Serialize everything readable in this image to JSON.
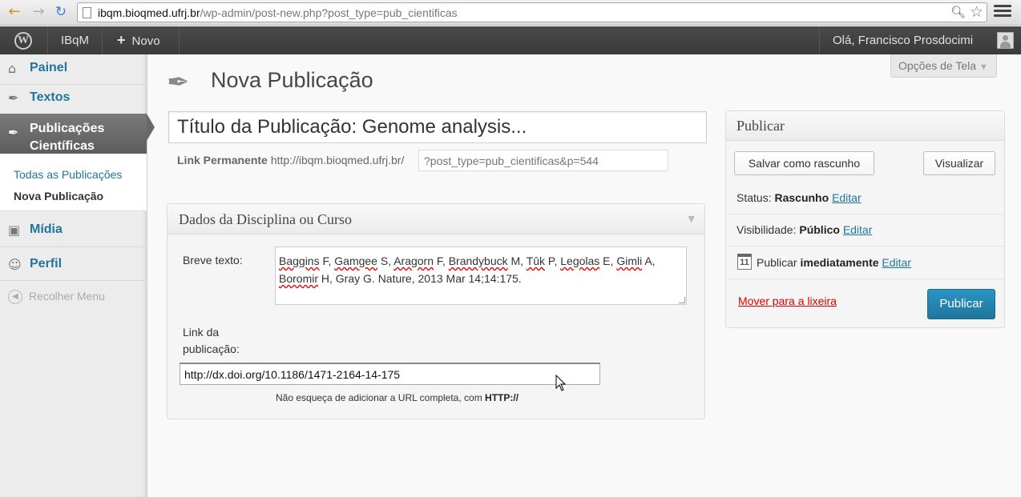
{
  "browser": {
    "url_host": "ibqm.bioqmed.ufrj.br",
    "url_path": "/wp-admin/post-new.php?post_type=pub_cientificas"
  },
  "adminbar": {
    "site_name": "IBqM",
    "new_label": "Novo",
    "greeting": "Olá, Francisco Prosdocimi"
  },
  "sidebar": {
    "items": [
      {
        "label": "Painel",
        "icon": "home-icon"
      },
      {
        "label": "Textos",
        "icon": "pushpin-icon"
      },
      {
        "label": "Publicações Científicas",
        "label_line1": "Publicações",
        "label_line2": "Científicas",
        "icon": "pushpin-icon"
      },
      {
        "label": "Mídia",
        "icon": "camera-icon"
      },
      {
        "label": "Perfil",
        "icon": "users-icon"
      }
    ],
    "submenu": [
      {
        "label": "Todas as Publicações"
      },
      {
        "label": "Nova Publicação"
      }
    ],
    "collapse_label": "Recolher Menu"
  },
  "header": {
    "screen_options": "Opções de Tela",
    "page_title": "Nova Publicação"
  },
  "editor": {
    "title_value": "Título da Publicação: Genome analysis...",
    "permalink_label": "Link Permanente",
    "permalink_base": "http://ibqm.bioqmed.ufrj.br/",
    "slug_placeholder": "?post_type=pub_cientificas&p=544"
  },
  "metabox": {
    "title": "Dados da Disciplina ou Curso",
    "breve_label": "Breve texto:",
    "breve_value": "Baggins F, Gamgee S, Aragorn F, Brandybuck M, Tûk P, Legolas E, Gimli A, Boromir H, Gray G. Nature, 2013 Mar 14;14:175.",
    "link_label": "Link da publicação:",
    "link_value": "http://dx.doi.org/10.1186/1471-2164-14-175",
    "hint_text": "Não esqueça de adicionar a URL completa, com",
    "hint_bold": "HTTP://"
  },
  "publish": {
    "title": "Publicar",
    "save_draft": "Salvar como rascunho",
    "preview": "Visualizar",
    "status_label": "Status:",
    "status_value": "Rascunho",
    "visibility_label": "Visibilidade:",
    "visibility_value": "Público",
    "when_label": "Publicar",
    "when_value": "imediatamente",
    "edit_label": "Editar",
    "calendar_day": "11",
    "trash_label": "Mover para a lixeira",
    "publish_button": "Publicar"
  },
  "colors": {
    "link": "#21759b",
    "publish_button": "#21759b",
    "trash": "#dd0000",
    "adminbar": "#464646"
  }
}
